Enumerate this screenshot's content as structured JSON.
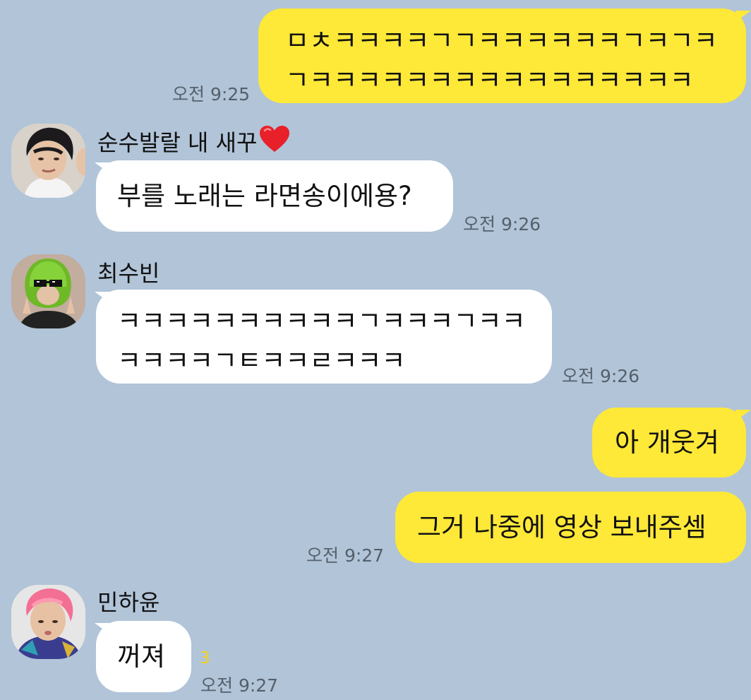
{
  "messages": {
    "m1": {
      "line1": "ㅁㅊㅋㅋㅋㅋㄱㄱㅋㅋㅋㅋㅋㅋㄱㅋㄱㅋ",
      "line2": "ㄱㅋㅋㅋㅋㅋㅋㅋㅋㅋㅋㅋㅋㅋㅋㅋㅋ",
      "time": "오전 9:25"
    },
    "m2": {
      "sender": "순수발랄 내 새꾸",
      "sender_emoji": "heart-icon",
      "text": "부를 노래는 라면송이에용?",
      "time": "오전 9:26"
    },
    "m3": {
      "sender": "최수빈",
      "line1": "ㅋㅋㅋㅋㅋㅋㅋㅋㅋㅋㄱㅋㅋㅋㄱㅋㅋ",
      "line2": "ㅋㅋㅋㅋㄱㅌㅋㅋㄹㅋㅋㅋ",
      "time": "오전 9:26"
    },
    "m4": {
      "text": "아 개웃겨"
    },
    "m5": {
      "text": "그거 나중에 영상 보내주셈",
      "time": "오전 9:27"
    },
    "m6": {
      "sender": "민하윤",
      "text": "꺼져",
      "unread": "3",
      "time": "오전 9:27"
    }
  },
  "colors": {
    "background": "#b1c4d8",
    "my_bubble": "#fee838",
    "their_bubble": "#ffffff",
    "timestamp": "#55606b",
    "unread_count": "#f7d117",
    "heart": "#e8202a"
  }
}
